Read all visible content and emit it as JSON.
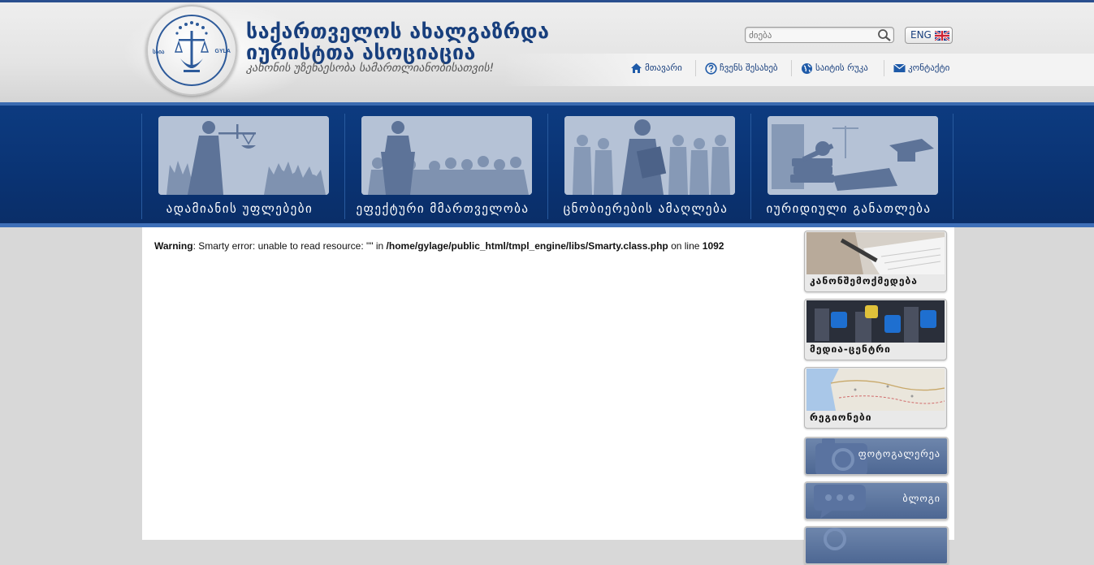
{
  "header": {
    "seal_left": "საია",
    "seal_right": "GYLA",
    "title_line1": "საქართველოს ახალგაზრდა",
    "title_line2": "იურისტთა ასოციაცია",
    "slogan": "კანონის უზენაესობა სამართლიანობისათვის!",
    "search_placeholder": "ძიება",
    "lang_label": "ENG"
  },
  "topnav": [
    {
      "label": "მთავარი",
      "icon": "home-icon"
    },
    {
      "label": "ჩვენს შესახებ",
      "icon": "question-icon"
    },
    {
      "label": "საიტის რუკა",
      "icon": "globe-icon"
    },
    {
      "label": "კონტაქტი",
      "icon": "mail-icon"
    }
  ],
  "mainnav": [
    {
      "label": "ადამიანის უფლებები"
    },
    {
      "label": "ეფექტური მმართველობა"
    },
    {
      "label": "ცნობიერების ამაღლება"
    },
    {
      "label": "იურიდიული განათლება"
    }
  ],
  "content": {
    "warning_label": "Warning",
    "warning_text": ": Smarty error: unable to read resource: \"\" in ",
    "warning_path": "/home/gylage/public_html/tmpl_engine/libs/Smarty.class.php",
    "warning_online": " on line ",
    "warning_line": "1092"
  },
  "sidebar": [
    {
      "label": "კანონშემოქმედება"
    },
    {
      "label": "მედია-ცენტრი"
    },
    {
      "label": "რეგიონები"
    },
    {
      "label": "ფოტოგალერეა"
    },
    {
      "label": "ბლოგი"
    }
  ],
  "colors": {
    "brand_blue": "#0d3b80",
    "title_blue": "#183f7d",
    "accent_blue": "#3e6fb8"
  }
}
